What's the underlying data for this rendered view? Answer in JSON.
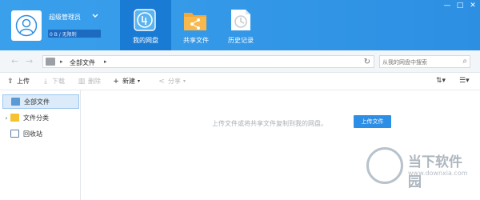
{
  "header": {
    "username": "超级管理员",
    "quota": "0 B / 无限制",
    "tabs": [
      {
        "label": "我的网盘",
        "active": true
      },
      {
        "label": "共享文件",
        "active": false
      },
      {
        "label": "历史记录",
        "active": false
      }
    ],
    "window_controls": [
      "minimize-icon",
      "restore-icon",
      "close-icon"
    ]
  },
  "addressbar": {
    "path": "全部文件",
    "search_placeholder": "从我的网盘中搜索"
  },
  "toolbar": {
    "upload": "上传",
    "download": "下载",
    "delete": "删除",
    "new": "新建",
    "share": "分享"
  },
  "sidebar": {
    "items": [
      {
        "label": "全部文件",
        "active": true
      },
      {
        "label": "文件分类",
        "active": false
      },
      {
        "label": "回收站",
        "active": false
      }
    ]
  },
  "main": {
    "empty_message": "上传文件或将共享文件复制到我的网盘。",
    "upload_button": "上传文件"
  },
  "watermark": {
    "title": "当下软件园",
    "sub": "www.downxia.com"
  },
  "colors": {
    "header": "#3aa0ec",
    "active_tab": "#1a7bd4",
    "accent": "#2d8ee5"
  }
}
